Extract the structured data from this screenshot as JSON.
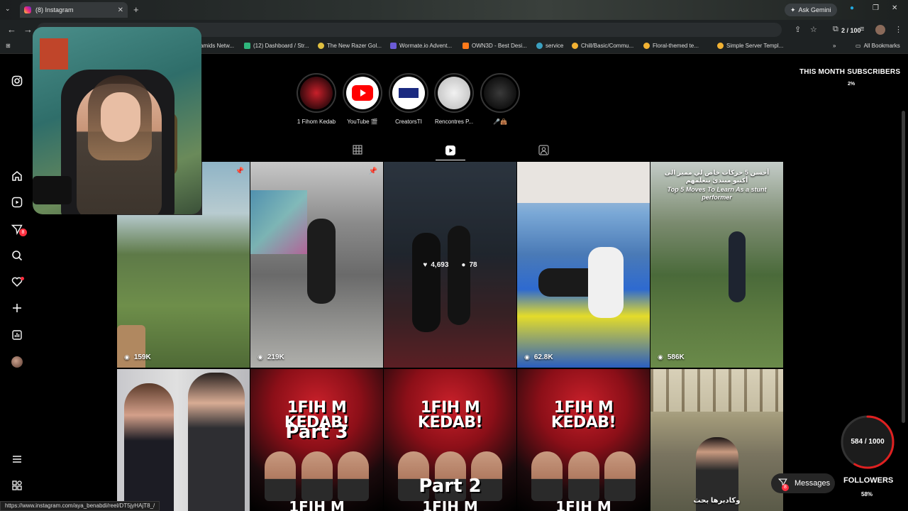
{
  "browser": {
    "tab_title": "(8) Instagram",
    "gemini_label": "Ask Gemini",
    "ext_count": "2 / 100",
    "bookmarks": [
      {
        "label": "amids Netw...",
        "color": "#444"
      },
      {
        "label": "(12) Dashboard / Str...",
        "color": "#2fb67c"
      },
      {
        "label": "The New Razer Gol...",
        "color": "#e0c040"
      },
      {
        "label": "Wormate.io Advent...",
        "color": "#6b5bd6"
      },
      {
        "label": "OWN3D - Best Desi...",
        "color": "#ff7a1a"
      },
      {
        "label": "service",
        "color": "#3aa0c0"
      },
      {
        "label": "Chill/Basic/Commu...",
        "color": "#f2b233"
      },
      {
        "label": "Floral-themed te...",
        "color": "#f2b233"
      },
      {
        "label": "Simple Server Templ...",
        "color": "#f2b233"
      }
    ],
    "all_bookmarks": "All Bookmarks",
    "status_url": "https://www.instagram.com/aya_benabdi/reel/DT5jyHAjT8_/"
  },
  "sidebar": {
    "notifications_badge": "8"
  },
  "stories": [
    {
      "label": "1 Fihom Kedab",
      "colors": [
        "#c8202a",
        "#1a0a0c"
      ]
    },
    {
      "label": "YouTube 🎬",
      "colors": [
        "#ff0000",
        "#ffffff"
      ]
    },
    {
      "label": "CreatorsTI",
      "colors": [
        "#ffffff",
        "#1b2a80"
      ]
    },
    {
      "label": "Rencontres P...",
      "colors": [
        "#e8e8e8",
        "#b0b0b0"
      ]
    },
    {
      "label": "🎤👜",
      "colors": [
        "#111111",
        "#ffffff"
      ]
    }
  ],
  "grid": {
    "row1": [
      {
        "views": "159K"
      },
      {
        "views": "219K"
      },
      {
        "likes": "4,693",
        "comments": "78"
      },
      {
        "views": "62.8K"
      },
      {
        "views": "586K",
        "caption_ar": "أحسن 5 حركات خاص لي مميز الى أكتبو مبتدئ بتعلمهم",
        "caption_en": "Top 5 Moves To Learn As a stunt performer"
      }
    ],
    "thumb_title_a": "1FIH",
    "thumb_title_b": "M",
    "thumb_title_c": "KEDAB!",
    "part3": "Part 3",
    "part2": "Part 2",
    "thumb_bottom": "1FIH M",
    "row2_last_caption": "وكادبرها بحث"
  },
  "overlays": {
    "subscribers_title": "THIS MONTH SUBSCRIBERS",
    "subscribers_pct": "2%",
    "goal_label": "584 / 1000",
    "goal_fraction": 0.584,
    "messages_label": "Messages",
    "messages_badge": "8",
    "followers_label": "FOLLOWERS",
    "followers_pct": "58%"
  }
}
